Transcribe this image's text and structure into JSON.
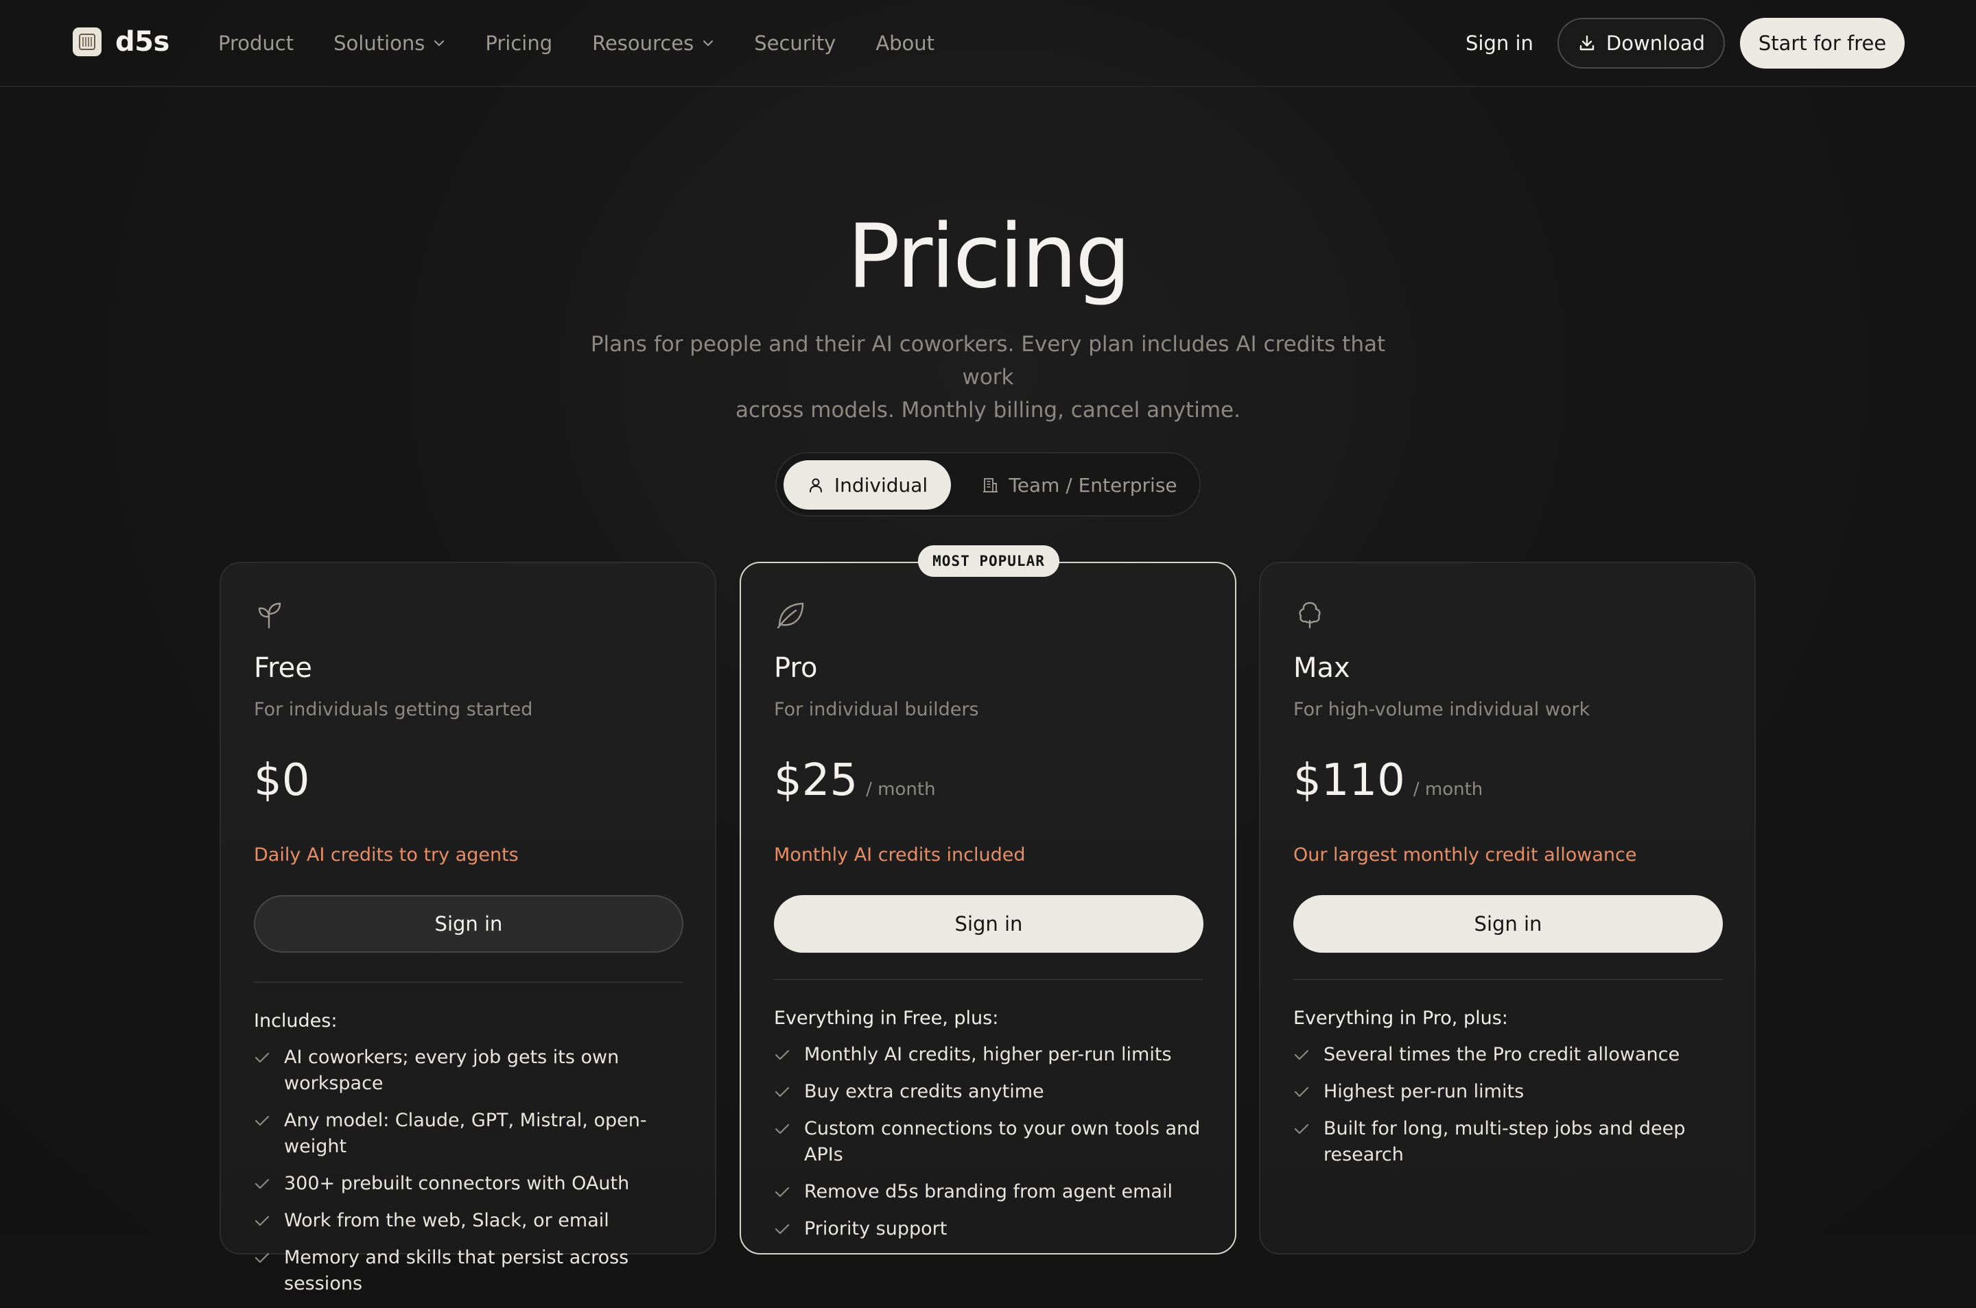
{
  "brand": {
    "name": "d5s"
  },
  "nav": {
    "items": [
      {
        "label": "Product"
      },
      {
        "label": "Solutions",
        "dropdown": true
      },
      {
        "label": "Pricing"
      },
      {
        "label": "Resources",
        "dropdown": true
      },
      {
        "label": "Security"
      },
      {
        "label": "About"
      }
    ],
    "sign_in": "Sign in",
    "download": "Download",
    "start": "Start for free"
  },
  "hero": {
    "title": "Pricing",
    "subtitle_line1": "Plans for people and their AI coworkers. Every plan includes AI credits that work",
    "subtitle_line2": "across models. Monthly billing, cancel anytime."
  },
  "toggle": {
    "active": "Individual",
    "inactive": "Team / Enterprise"
  },
  "plans": [
    {
      "icon": "sprout-icon",
      "name": "Free",
      "description": "For individuals getting started",
      "price": "$0",
      "period": "",
      "credit_note": "Daily AI credits to try agents",
      "cta": "Sign in",
      "features_heading": "Includes:",
      "features": [
        "AI coworkers; every job gets its own workspace",
        "Any model: Claude, GPT, Mistral, open-weight",
        "300+ prebuilt connectors with OAuth",
        "Work from the web, Slack, or email",
        "Memory and skills that persist across sessions"
      ]
    },
    {
      "icon": "leaf-icon",
      "badge": "MOST POPULAR",
      "name": "Pro",
      "description": "For individual builders",
      "price": "$25",
      "period": "/ month",
      "credit_note": "Monthly AI credits included",
      "cta": "Sign in",
      "features_heading": "Everything in Free, plus:",
      "features": [
        "Monthly AI credits, higher per-run limits",
        "Buy extra credits anytime",
        "Custom connections to your own tools and APIs",
        "Remove d5s branding from agent email",
        "Priority support"
      ]
    },
    {
      "icon": "tree-icon",
      "name": "Max",
      "description": "For high-volume individual work",
      "price": "$110",
      "period": "/ month",
      "credit_note": "Our largest monthly credit allowance",
      "cta": "Sign in",
      "features_heading": "Everything in Pro, plus:",
      "features": [
        "Several times the Pro credit allowance",
        "Highest per-run limits",
        "Built for long, multi-step jobs and deep research"
      ]
    }
  ],
  "colors": {
    "background": "#141414",
    "card": "#1d1d1d",
    "accent": "#e88e66",
    "light_button": "#ece9e3",
    "muted_text": "#8c8983"
  }
}
